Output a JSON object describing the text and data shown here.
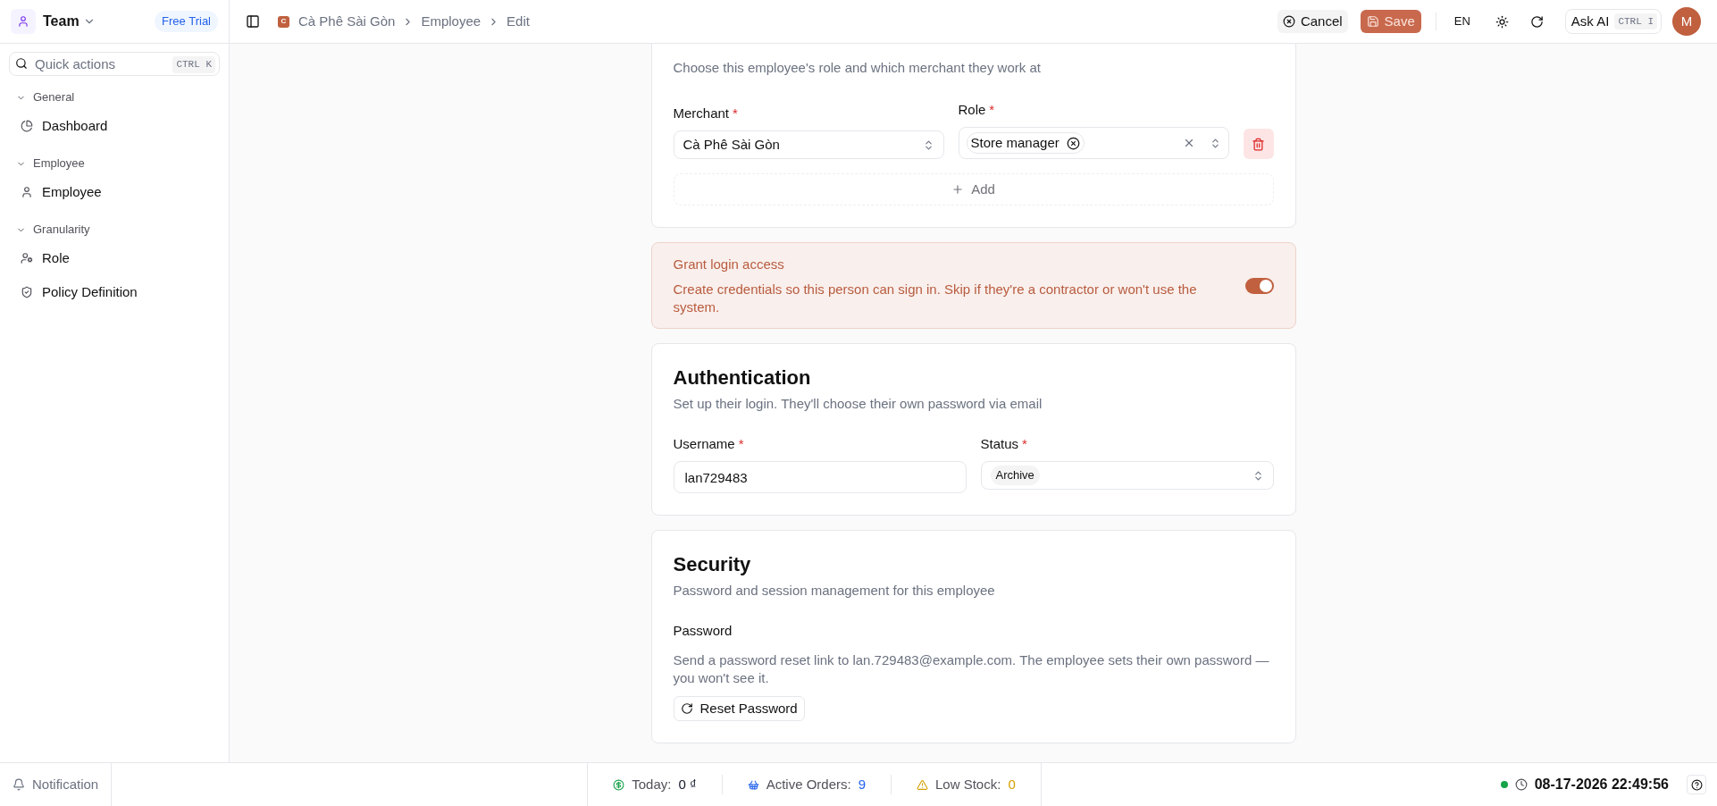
{
  "sidebar": {
    "team": "Team",
    "plan_badge": "Free Trial",
    "search": {
      "placeholder": "Quick actions",
      "shortcut": "CTRL K"
    },
    "groups": [
      {
        "label": "General",
        "expanded": true,
        "items": [
          {
            "label": "Dashboard"
          }
        ]
      },
      {
        "label": "Employee",
        "expanded": true,
        "items": [
          {
            "label": "Employee"
          }
        ]
      },
      {
        "label": "Granularity",
        "expanded": true,
        "items": [
          {
            "label": "Role"
          },
          {
            "label": "Policy Definition"
          }
        ]
      }
    ]
  },
  "header": {
    "logo_letter": "C",
    "breadcrumb": [
      "Cà Phê Sài Gòn",
      "Employee",
      "Edit"
    ],
    "cancel": "Cancel",
    "save": "Save",
    "language": "EN",
    "ask_ai": {
      "label": "Ask AI",
      "shortcut": "CTRL I"
    },
    "avatar": "M"
  },
  "authorization": {
    "subtitle": "Choose this employee's role and which merchant they work at",
    "assignments": [
      {
        "merchant_label": "Merchant",
        "merchant_mark": "*",
        "merchant": "Cà Phê Sài Gòn",
        "role_label": "Role",
        "role_mark": "*",
        "roles": [
          "Store manager"
        ]
      }
    ],
    "add": "Add"
  },
  "login_access": {
    "title": "Grant login access",
    "text": "Create credentials so this person can sign in. Skip if they're a contractor or won't use the system.",
    "on": true
  },
  "authentication": {
    "title": "Authentication",
    "subtitle": "Set up their login. They'll choose their own password via email",
    "username": {
      "label": "Username",
      "mark": "*",
      "value": "lan729483"
    },
    "status": {
      "label": "Status",
      "mark": "*",
      "value": "Archive"
    }
  },
  "security": {
    "title": "Security",
    "subtitle": "Password and session management for this employee",
    "password_label": "Password",
    "text": "Send a password reset link to lan.729483@example.com. The employee sets their own password — you won't see it.",
    "button": "Reset Password"
  },
  "status_bar": {
    "notification": "Notification",
    "metrics": [
      {
        "label": "Today:",
        "value": "0 ₫",
        "color": "#111827"
      },
      {
        "label": "Active Orders:",
        "value": "9",
        "color": "#2563eb"
      },
      {
        "label": "Low Stock:",
        "value": "0",
        "color": "#d4a000"
      }
    ],
    "datetime": "08-17-2026 22:49:56"
  }
}
